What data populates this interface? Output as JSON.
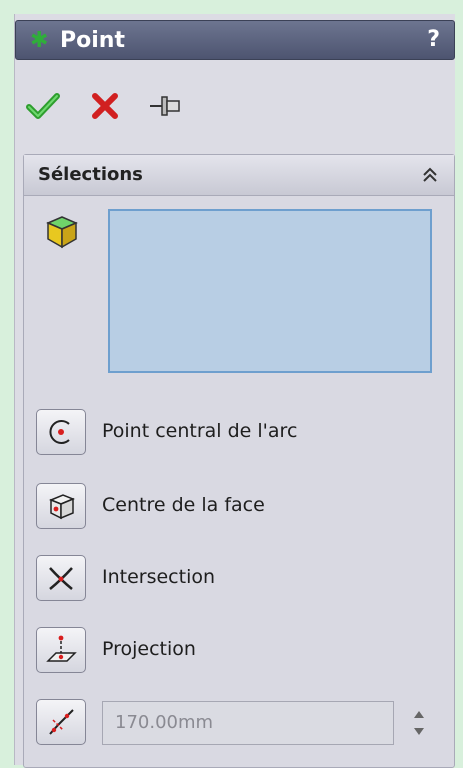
{
  "panel": {
    "title": "Point",
    "help": "?"
  },
  "selections": {
    "title": "Sélections"
  },
  "options": [
    {
      "label": "Point central de l'arc"
    },
    {
      "label": "Centre de la face"
    },
    {
      "label": "Intersection"
    },
    {
      "label": "Projection"
    }
  ],
  "distance": {
    "value": "170.00mm"
  },
  "icons": {
    "title": "point-feature-icon",
    "ok": "checkmark-icon",
    "cancel": "close-icon",
    "pin": "pushpin-icon",
    "collapse": "double-chevron-up-icon",
    "selection": "face-cube-icon",
    "arc_center": "arc-center-icon",
    "face_center": "face-center-icon",
    "intersection": "intersection-icon",
    "projection": "projection-icon",
    "distance": "distance-along-curve-icon"
  },
  "colors": {
    "title_bar": "#5b6280",
    "accent_green": "#2fae3a",
    "cancel_red": "#d12020",
    "selection_box": "#b8cee4"
  }
}
